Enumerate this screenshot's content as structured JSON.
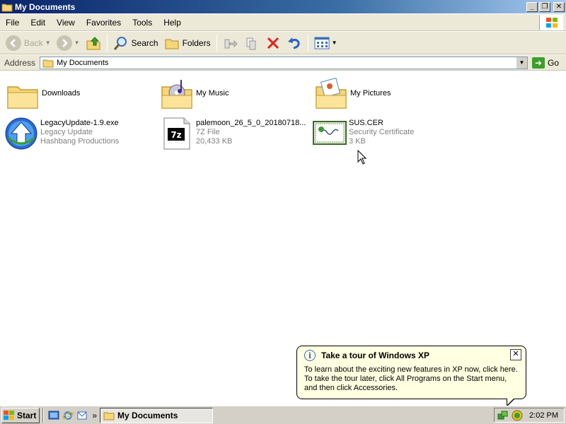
{
  "window": {
    "title": "My Documents",
    "controls": {
      "minimize": "_",
      "maximize": "❐",
      "close": "✕"
    }
  },
  "menu": [
    "File",
    "Edit",
    "View",
    "Favorites",
    "Tools",
    "Help"
  ],
  "toolbar": {
    "back_label": "Back",
    "search_label": "Search",
    "folders_label": "Folders"
  },
  "address": {
    "label": "Address",
    "value": "My Documents",
    "go_label": "Go"
  },
  "files": [
    {
      "name": "Downloads",
      "type": "",
      "detail": "",
      "icon": "folder-icon"
    },
    {
      "name": "My Music",
      "type": "",
      "detail": "",
      "icon": "music-folder-icon"
    },
    {
      "name": "My Pictures",
      "type": "",
      "detail": "",
      "icon": "pictures-folder-icon"
    },
    {
      "name": "LegacyUpdate-1.9.exe",
      "type": "Legacy Update",
      "detail": "Hashbang Productions",
      "icon": "update-arrow-icon"
    },
    {
      "name": "palemoon_26_5_0_20180718...",
      "type": "7Z File",
      "detail": "20,433 KB",
      "icon": "7z-archive-icon"
    },
    {
      "name": "SUS.CER",
      "type": "Security Certificate",
      "detail": "3 KB",
      "icon": "certificate-icon"
    }
  ],
  "balloon": {
    "title": "Take a tour of Windows XP",
    "lines": [
      "To learn about the exciting new features in XP now, click here.",
      "To take the tour later, click All Programs on the Start menu,",
      "and then click Accessories."
    ],
    "close": "✕"
  },
  "taskbar": {
    "start_label": "Start",
    "overflow": "»",
    "task_label": "My Documents",
    "clock": "2:02 PM"
  }
}
